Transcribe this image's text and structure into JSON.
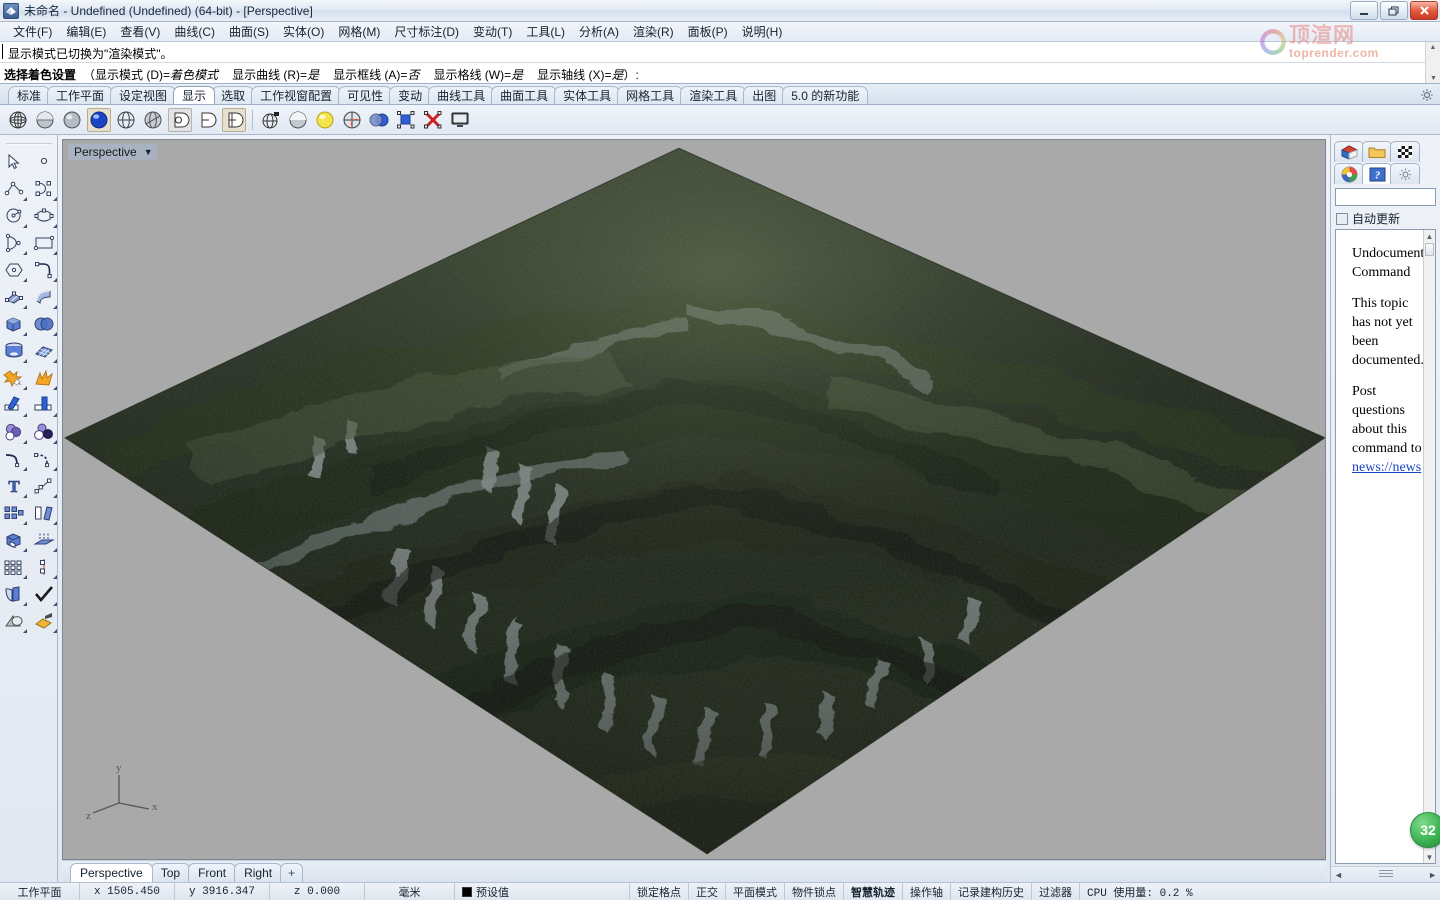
{
  "window": {
    "title": "未命名 - Undefined (Undefined) (64-bit) - [Perspective]",
    "minimize_label": "–",
    "restore_label": "❐",
    "close_label": "✕"
  },
  "menubar": {
    "items": [
      {
        "label": "文件(F)"
      },
      {
        "label": "编辑(E)"
      },
      {
        "label": "查看(V)"
      },
      {
        "label": "曲线(C)"
      },
      {
        "label": "曲面(S)"
      },
      {
        "label": "实体(O)"
      },
      {
        "label": "网格(M)"
      },
      {
        "label": "尺寸标注(D)"
      },
      {
        "label": "变动(T)"
      },
      {
        "label": "工具(L)"
      },
      {
        "label": "分析(A)"
      },
      {
        "label": "渲染(R)"
      },
      {
        "label": "面板(P)"
      },
      {
        "label": "说明(H)"
      }
    ]
  },
  "command": {
    "history_line": "显示模式已切换为\"渲染模式\"。",
    "prompt_label": "选择着色设置",
    "prompt_open": "（",
    "prompt_close": "）:",
    "options": [
      {
        "name": "显示模式 (D)=",
        "value": "着色模式"
      },
      {
        "name": "显示曲线 (R)=",
        "value": "是"
      },
      {
        "name": "显示框线 (A)=",
        "value": "否"
      },
      {
        "name": "显示格线 (W)=",
        "value": "是"
      },
      {
        "name": "显示轴线 (X)=",
        "value": "是"
      }
    ]
  },
  "toolbar_tabs": {
    "items": [
      {
        "label": "标准",
        "active": false
      },
      {
        "label": "工作平面",
        "active": false
      },
      {
        "label": "设定视图",
        "active": false
      },
      {
        "label": "显示",
        "active": true
      },
      {
        "label": "选取",
        "active": false
      },
      {
        "label": "工作视窗配置",
        "active": false
      },
      {
        "label": "可见性",
        "active": false
      },
      {
        "label": "变动",
        "active": false
      },
      {
        "label": "曲线工具",
        "active": false
      },
      {
        "label": "曲面工具",
        "active": false
      },
      {
        "label": "实体工具",
        "active": false
      },
      {
        "label": "网格工具",
        "active": false
      },
      {
        "label": "渲染工具",
        "active": false
      },
      {
        "label": "出图",
        "active": false
      },
      {
        "label": "5.0 的新功能",
        "active": false
      }
    ],
    "settings_icon": "gear-icon"
  },
  "display_toolbar": {
    "buttons": [
      {
        "icon": "wireframe-sphere-icon",
        "state": "normal"
      },
      {
        "icon": "shaded-sphere-icon",
        "state": "normal"
      },
      {
        "icon": "rendered-sphere-icon",
        "state": "normal"
      },
      {
        "icon": "render-mode-sphere-icon",
        "state": "selected"
      },
      {
        "icon": "ghosted-sphere-icon",
        "state": "normal"
      },
      {
        "icon": "xray-sphere-icon",
        "state": "normal"
      },
      {
        "icon": "technical-sphere-icon",
        "state": "pressed"
      },
      {
        "icon": "artistic-sphere-icon",
        "state": "normal"
      },
      {
        "icon": "pen-sphere-icon",
        "state": "pressed"
      },
      {
        "icon": "shade-command-icon",
        "state": "normal"
      },
      {
        "icon": "flat-shade-icon",
        "state": "normal"
      },
      {
        "icon": "light-sphere-icon",
        "state": "normal"
      },
      {
        "icon": "render-preview-icon",
        "state": "normal"
      },
      {
        "icon": "color-spheres-icon",
        "state": "normal"
      },
      {
        "icon": "zoom-selected-icon",
        "state": "normal"
      },
      {
        "icon": "clear-display-icon",
        "state": "normal"
      },
      {
        "icon": "fullscreen-monitor-icon",
        "state": "normal"
      }
    ]
  },
  "left_palette": {
    "rows": [
      [
        {
          "icon": "arrow-select-icon"
        },
        {
          "icon": "point-icon"
        }
      ],
      [
        {
          "icon": "polyline-icon"
        },
        {
          "icon": "control-point-curve-icon"
        }
      ],
      [
        {
          "icon": "circle-icon"
        },
        {
          "icon": "ellipse-icon"
        }
      ],
      [
        {
          "icon": "arc-icon"
        },
        {
          "icon": "rectangle-icon"
        }
      ],
      [
        {
          "icon": "polygon-icon"
        },
        {
          "icon": "curve-fillet-icon"
        }
      ],
      [
        {
          "icon": "surface-from-points-icon"
        },
        {
          "icon": "extrude-surface-icon"
        }
      ],
      [
        {
          "icon": "box-icon"
        },
        {
          "icon": "boolean-spheres-icon"
        }
      ],
      [
        {
          "icon": "cylinder-icon"
        },
        {
          "icon": "mesh-plane-icon"
        }
      ],
      [
        {
          "icon": "boolean-union-icon"
        },
        {
          "icon": "explode-icon"
        }
      ],
      [
        {
          "icon": "trim-icon"
        },
        {
          "icon": "split-icon"
        }
      ],
      [
        {
          "icon": "boolean-difference-icon"
        },
        {
          "icon": "boolean-intersection-icon"
        }
      ],
      [
        {
          "icon": "fillet-curve-icon"
        },
        {
          "icon": "blend-curve-icon"
        }
      ],
      [
        {
          "icon": "text-object-icon"
        },
        {
          "icon": "scale-icon"
        }
      ],
      [
        {
          "icon": "array-icon"
        },
        {
          "icon": "offset-icon"
        }
      ],
      [
        {
          "icon": "cap-holes-icon"
        },
        {
          "icon": "extrude-curve-icon"
        }
      ],
      [
        {
          "icon": "grid-array-icon"
        },
        {
          "icon": "mirror-icon"
        }
      ],
      [
        {
          "icon": "unroll-surface-icon"
        },
        {
          "icon": "check-object-icon"
        }
      ],
      [
        {
          "icon": "shade-objects-icon"
        },
        {
          "icon": "render-object-icon"
        }
      ]
    ]
  },
  "viewport": {
    "name": "Perspective",
    "dropdown_icon": "chevron-down-icon",
    "background_color": "#a9a9a9",
    "axis_gizmo": {
      "x": "x",
      "y": "y",
      "z": "z"
    },
    "tabs": [
      {
        "label": "Perspective",
        "active": true
      },
      {
        "label": "Top",
        "active": false
      },
      {
        "label": "Front",
        "active": false
      },
      {
        "label": "Right",
        "active": false
      },
      {
        "label": "+",
        "active": false
      }
    ]
  },
  "right_panel": {
    "tabs_row1": [
      {
        "icon": "rhino-layers-icon",
        "active": false
      },
      {
        "icon": "folder-icon",
        "active": false
      },
      {
        "icon": "checker-texture-icon",
        "active": false
      }
    ],
    "tabs_row2": [
      {
        "icon": "color-wheel-icon",
        "active": false
      },
      {
        "icon": "help-icon",
        "active": true
      },
      {
        "icon": "gear-icon",
        "active": false
      }
    ],
    "search_value": "",
    "search_placeholder": "",
    "auto_update_label": "自动更新",
    "auto_update_checked": false,
    "help": {
      "heading": "Undocumented Command",
      "body": "This topic has not yet been documented.",
      "post_text": "Post questions about this command to",
      "link": "news://news"
    },
    "badge": "32"
  },
  "statusbar": {
    "cplane_label": "工作平面",
    "x": "x 1505.450",
    "y": "y 3916.347",
    "z": "z 0.000",
    "units": "毫米",
    "layer": "预设值",
    "layer_color": "#000000",
    "toggles": [
      {
        "label": "锁定格点",
        "bold": false
      },
      {
        "label": "正交",
        "bold": false
      },
      {
        "label": "平面模式",
        "bold": false
      },
      {
        "label": "物件锁点",
        "bold": false
      },
      {
        "label": "智慧轨迹",
        "bold": true
      },
      {
        "label": "操作轴",
        "bold": false
      },
      {
        "label": "记录建构历史",
        "bold": false
      },
      {
        "label": "过滤器",
        "bold": false
      }
    ],
    "cpu": "CPU 使用量: 0.2 %"
  },
  "watermark": {
    "cn": "顶渲网",
    "en": "toprender.com"
  }
}
